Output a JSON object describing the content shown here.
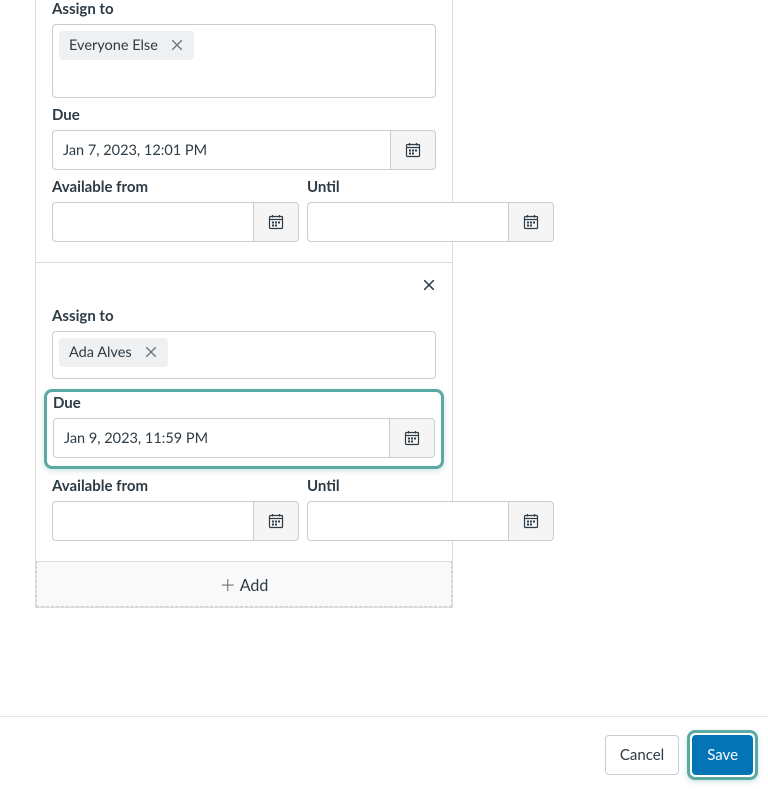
{
  "sections": [
    {
      "assign_label": "Assign to",
      "assignee": "Everyone Else",
      "due_label": "Due",
      "due_value": "Jan 7, 2023, 12:01 PM",
      "available_label": "Available from",
      "available_value": "",
      "until_label": "Until",
      "until_value": ""
    },
    {
      "assign_label": "Assign to",
      "assignee": "Ada Alves",
      "due_label": "Due",
      "due_value": "Jan 9, 2023, 11:59 PM",
      "available_label": "Available from",
      "available_value": "",
      "until_label": "Until",
      "until_value": ""
    }
  ],
  "add_label": "Add",
  "footer": {
    "cancel": "Cancel",
    "save": "Save"
  }
}
